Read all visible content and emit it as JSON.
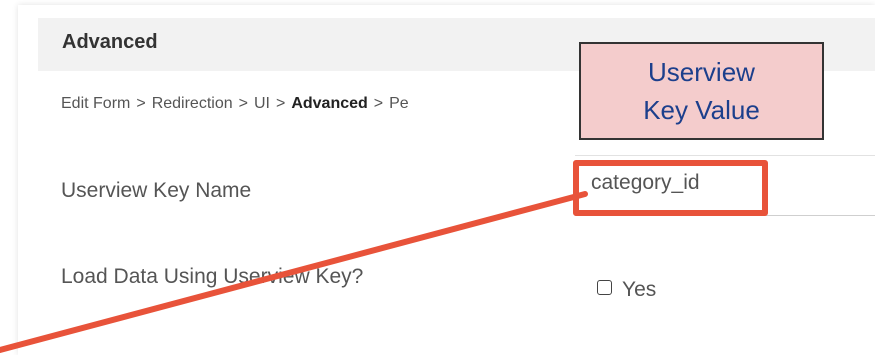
{
  "section": {
    "title": "Advanced"
  },
  "breadcrumb": {
    "items": [
      "Edit Form",
      "Redirection",
      "UI",
      "Advanced",
      "Pe"
    ],
    "separator": ">"
  },
  "fields": {
    "userview_key_name": {
      "label": "Userview Key Name",
      "value": "category_id"
    },
    "load_data": {
      "label": "Load Data Using Userview Key?",
      "option_label": "Yes",
      "checked": false
    }
  },
  "annotation": {
    "callout_line1": "Userview",
    "callout_line2": "Key Value",
    "highlight_color": "#e8533a",
    "callout_bg": "#f4cccc",
    "callout_text_color": "#1c3f8c"
  }
}
